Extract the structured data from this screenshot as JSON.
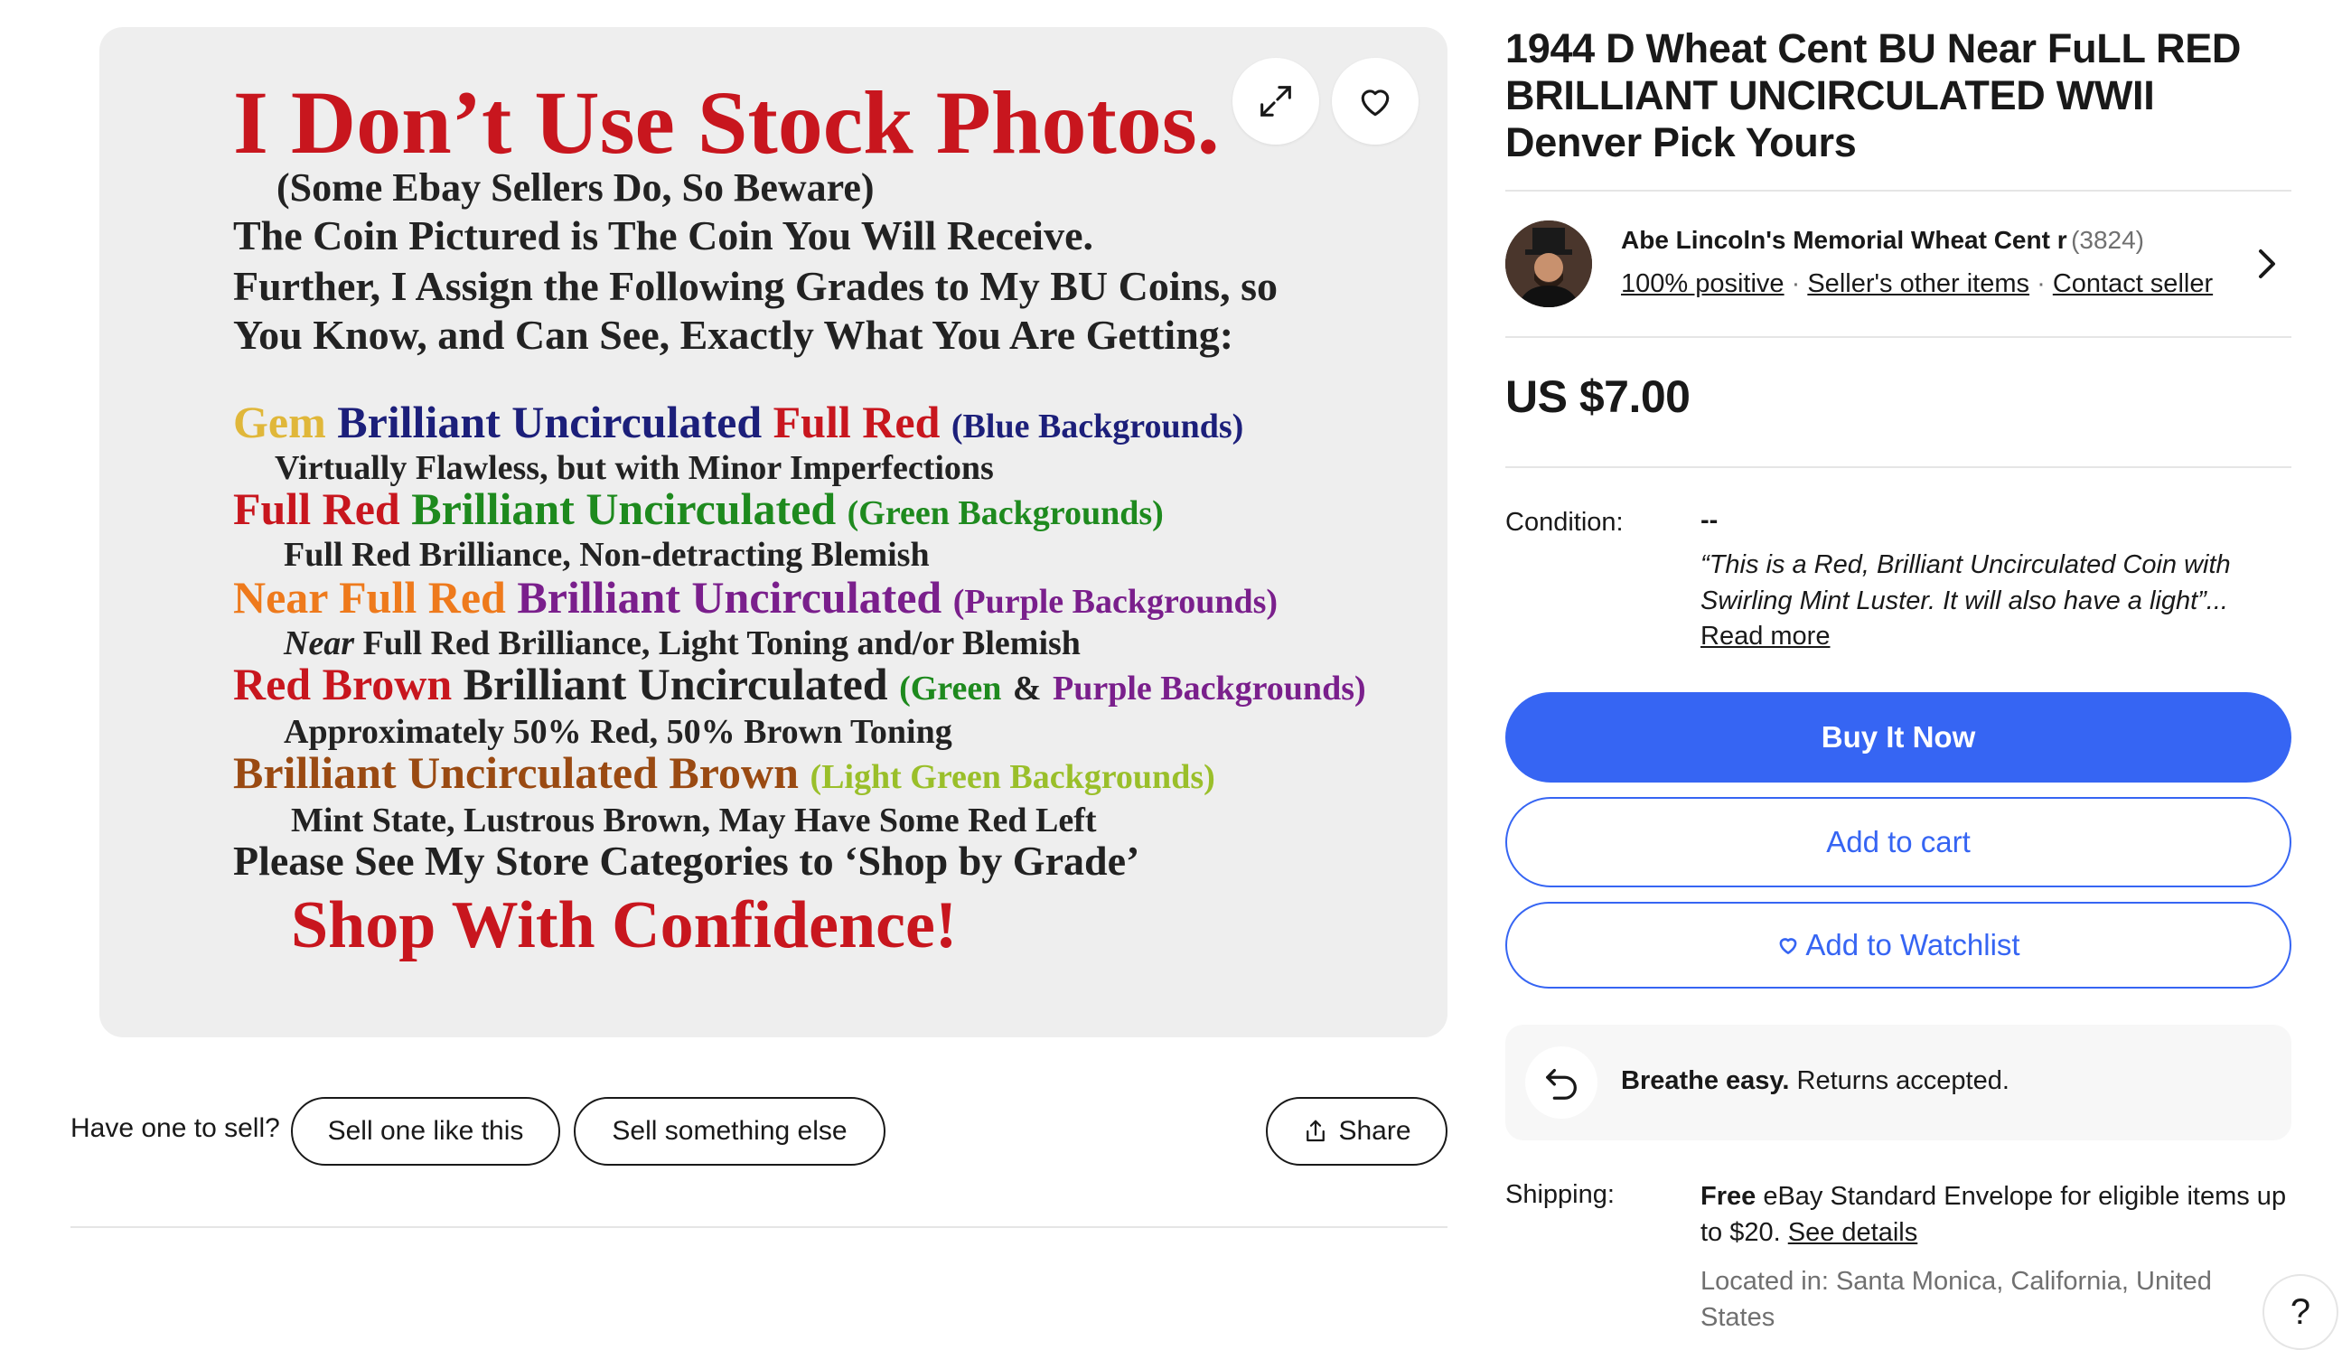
{
  "image": {
    "headline": "I Don’t Use Stock Photos.",
    "sub": "(Some Ebay Sellers Do, So Beware)",
    "body1": "The Coin Pictured is The Coin You Will Receive.",
    "body2": "Further, I Assign the Following Grades to My BU Coins, so",
    "body3": "You Know, and Can See, Exactly What You Are Getting:",
    "g1": {
      "a": "Gem",
      "b": "Brilliant Uncirculated",
      "c": "Full Red",
      "d": "(Blue Backgrounds)",
      "note": "Virtually Flawless, but with Minor Imperfections"
    },
    "g2": {
      "a": "Full Red",
      "b": "Brilliant Uncirculated",
      "c": "(Green Backgrounds)",
      "note": "Full Red Brilliance, Non-detracting Blemish"
    },
    "g3": {
      "a": "Near Full Red",
      "b": "Brilliant Uncirculated",
      "c": "(Purple Backgrounds)",
      "note_em": "Near",
      "note": "Full Red Brilliance, Light Toning and/or Blemish"
    },
    "g4": {
      "a": "Red Brown",
      "b": "Brilliant Uncirculated",
      "c": "(Green",
      "d": "&",
      "e": "Purple Backgrounds)",
      "note": "Approximately 50% Red, 50% Brown Toning"
    },
    "g5": {
      "a": "Brilliant Uncirculated Brown",
      "b": "(Light Green Backgrounds)",
      "note": "Mint State, Lustrous Brown, May Have Some Red Left"
    },
    "store": "Please See My Store Categories to ‘Shop by Grade’",
    "confidence": "Shop With Confidence!",
    "expand_icon": "expand-icon",
    "heart_icon": "heart-icon"
  },
  "sell": {
    "prompt": "Have one to sell?",
    "like_this": "Sell one like this",
    "something_else": "Sell something else",
    "share": "Share"
  },
  "listing": {
    "title": "1944 D Wheat Cent BU Near FuLL RED BRILLIANT UNCIRCULATED WWII Denver Pick Yours",
    "seller": {
      "name": "Abe Lincoln's Memorial Wheat Cent r",
      "count": "(3824)",
      "positive": "100% positive",
      "other_items": "Seller's other items",
      "contact": "Contact seller"
    },
    "price": "US $7.00",
    "condition_label": "Condition:",
    "condition_value": "--",
    "condition_desc": "“This is a Red, Brilliant Uncirculated Coin with Swirling Mint Luster. It will also have a light”...",
    "read_more": "Read more",
    "buy_now": "Buy It Now",
    "add_cart": "Add to cart",
    "watchlist": "Add to Watchlist",
    "returns_bold": "Breathe easy.",
    "returns_text": "Returns accepted.",
    "shipping_label": "Shipping:",
    "shipping_free": "Free",
    "shipping_text": "eBay Standard Envelope for eligible items up to $20.",
    "see_details": "See details",
    "located": "Located in: Santa Monica, California, United States",
    "help": "?"
  },
  "colors": {
    "accent": "#3665f3",
    "text": "#191919",
    "muted": "#707070",
    "panel": "#eeeeee"
  }
}
